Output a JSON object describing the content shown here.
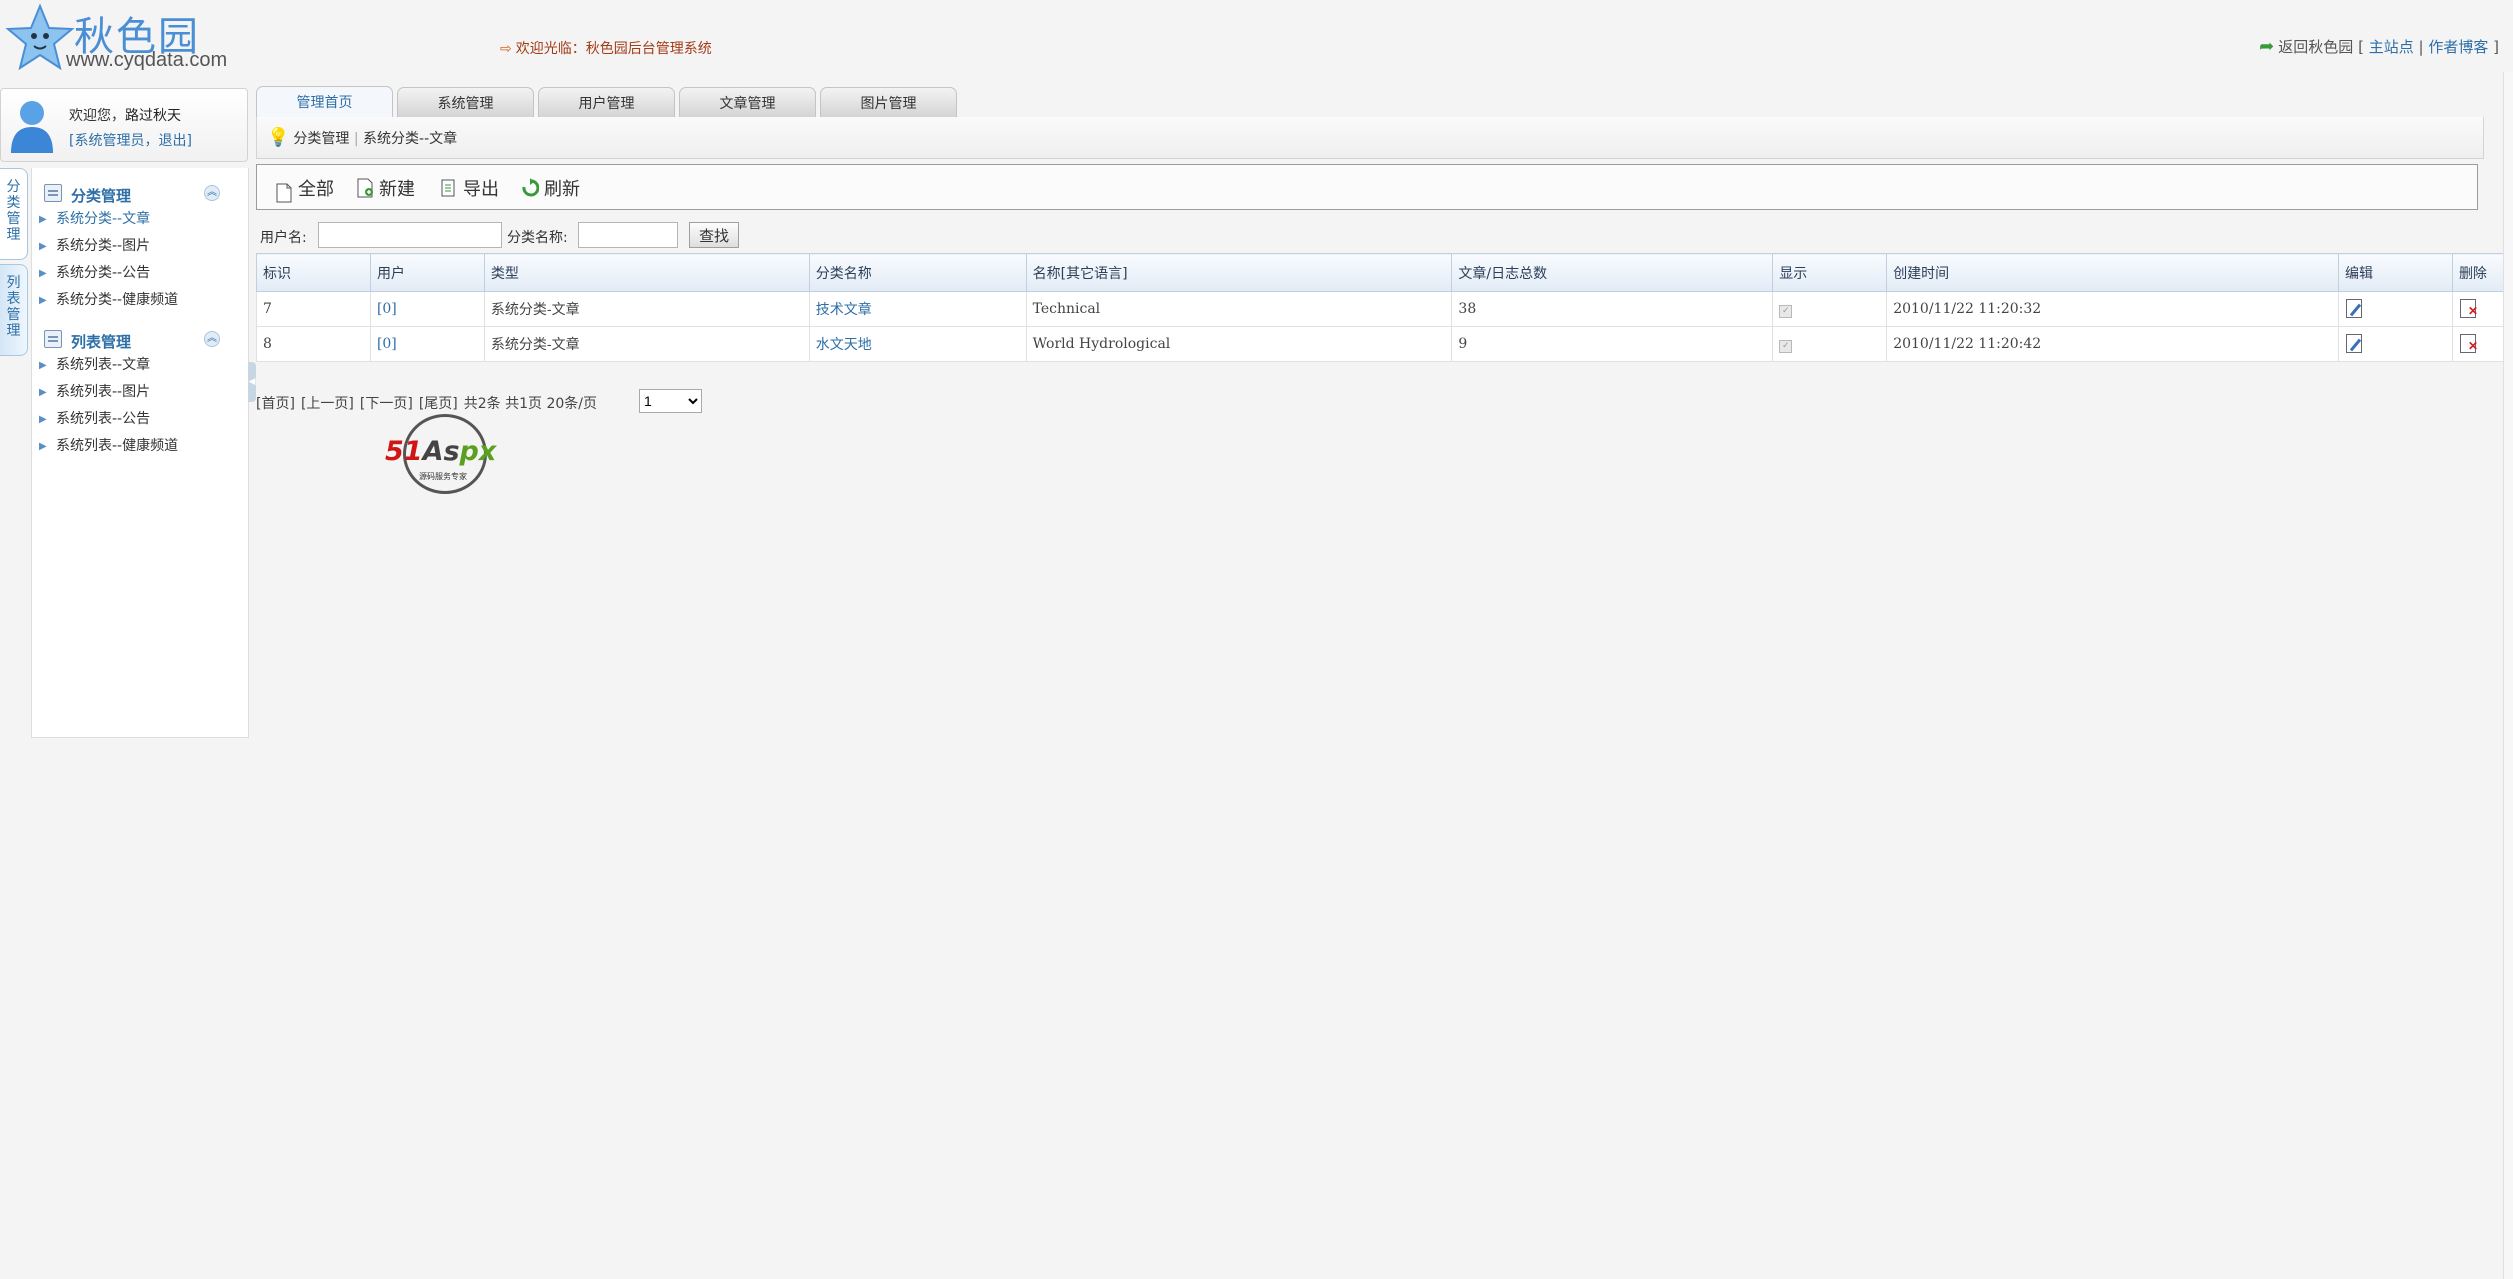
{
  "header": {
    "logo_title": "秋色园",
    "logo_url": "www.cyqdata.com",
    "welcome": "欢迎光临：秋色园后台管理系统",
    "return_label": "返回秋色园",
    "bracket_open": "[",
    "main_site": "主站点",
    "sep": "|",
    "author_blog": "作者博客",
    "bracket_close": "]"
  },
  "user": {
    "greeting": "欢迎您，",
    "name": "路过秋天",
    "role": "[系统管理员，",
    "logout": "退出",
    "role_close": "]"
  },
  "side_tabs": [
    "分类管理",
    "列表管理"
  ],
  "sidebar": {
    "groups": [
      {
        "title": "分类管理",
        "items": [
          "系统分类--文章",
          "系统分类--图片",
          "系统分类--公告",
          "系统分类--健康频道"
        ]
      },
      {
        "title": "列表管理",
        "items": [
          "系统列表--文章",
          "系统列表--图片",
          "系统列表--公告",
          "系统列表--健康频道"
        ]
      }
    ]
  },
  "tabs": [
    "管理首页",
    "系统管理",
    "用户管理",
    "文章管理",
    "图片管理"
  ],
  "breadcrumb": {
    "part1": "分类管理",
    "sep": "|",
    "part2": "系统分类--文章"
  },
  "toolbar": {
    "all": "全部",
    "new": "新建",
    "export": "导出",
    "refresh": "刷新"
  },
  "search": {
    "username_label": "用户名:",
    "category_label": "分类名称:",
    "username_value": "",
    "category_value": "",
    "button": "查找"
  },
  "table": {
    "headers": [
      "标识",
      "用户",
      "类型",
      "分类名称",
      "名称[其它语言]",
      "文章/日志总数",
      "显示",
      "创建时间",
      "编辑",
      "删除"
    ],
    "rows": [
      {
        "id": "7",
        "user": "[0]",
        "type": "系统分类-文章",
        "name": "技术文章",
        "name_other": "Technical",
        "count": "38",
        "show": true,
        "created": "2010/11/22 11:20:32"
      },
      {
        "id": "8",
        "user": "[0]",
        "type": "系统分类-文章",
        "name": "水文天地",
        "name_other": "World Hydrological",
        "count": "9",
        "show": true,
        "created": "2010/11/22 11:20:42"
      }
    ]
  },
  "pager": {
    "first": "[首页]",
    "prev": "[上一页]",
    "next": "[下一页]",
    "last": "[尾页]",
    "summary": "共2条 共1页 20条/页",
    "page_select": "1"
  },
  "watermark": {
    "brand_red": "51",
    "brand_grey": "As",
    "brand_green": "px",
    "sub": "源码服务专家"
  },
  "colors": {
    "link": "#2e6fa7",
    "welcome": "#a33b16",
    "header_bg": "#e2ebf6"
  }
}
